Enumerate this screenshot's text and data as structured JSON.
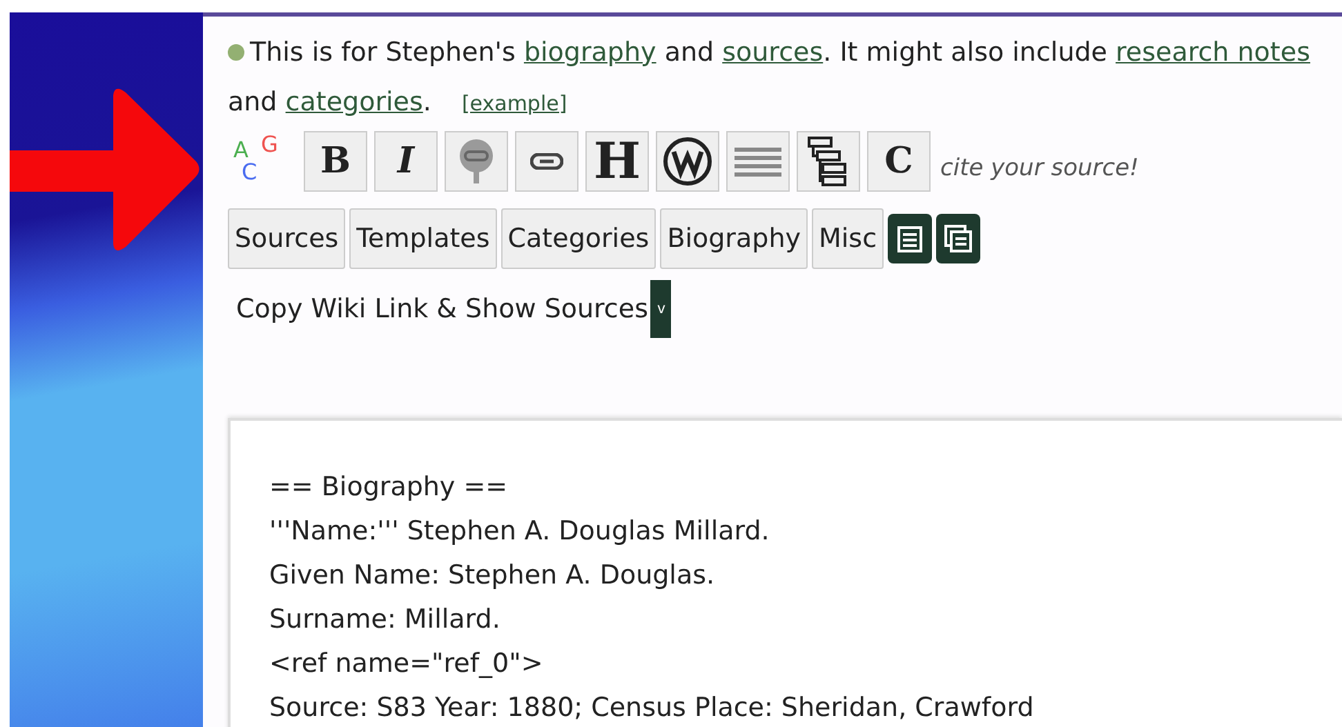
{
  "intro": {
    "parts": [
      {
        "kind": "text",
        "text": "This is for Stephen's "
      },
      {
        "kind": "link",
        "text": "biography"
      },
      {
        "kind": "text",
        "text": " and "
      },
      {
        "kind": "link",
        "text": "sources"
      },
      {
        "kind": "text",
        "text": ". It might also include "
      },
      {
        "kind": "link",
        "text": "research notes"
      },
      {
        "kind": "text",
        "text": " and "
      },
      {
        "kind": "link",
        "text": "categories"
      },
      {
        "kind": "text",
        "text": "."
      }
    ],
    "example": "[example]"
  },
  "toolbar": [
    {
      "kind": "agc",
      "label": "A G C"
    },
    {
      "kind": "bold",
      "label": "B"
    },
    {
      "kind": "italic",
      "label": "I"
    },
    {
      "kind": "tree"
    },
    {
      "kind": "link"
    },
    {
      "kind": "heading",
      "label": "H"
    },
    {
      "kind": "wiki"
    },
    {
      "kind": "lines"
    },
    {
      "kind": "outline"
    },
    {
      "kind": "cite",
      "label": "C"
    }
  ],
  "toolbar_hint": "cite your source!",
  "tabs": [
    "Sources",
    "Templates",
    "Categories",
    "Biography",
    "Misc"
  ],
  "tab_icon_buttons": [
    {
      "kind": "clipboard"
    },
    {
      "kind": "copy"
    }
  ],
  "copy_link": {
    "label": "Copy Wiki Link & Show Sources",
    "dropdown": "v"
  },
  "editor_lines": [
    "== Biography ==",
    "'''Name:''' Stephen A. Douglas Millard.",
    "Given Name: Stephen A. Douglas.",
    "Surname: Millard.",
    "<ref name=\"ref_0\">",
    "Source: S83 Year: 1880; Census Place: Sheridan, Crawford"
  ]
}
